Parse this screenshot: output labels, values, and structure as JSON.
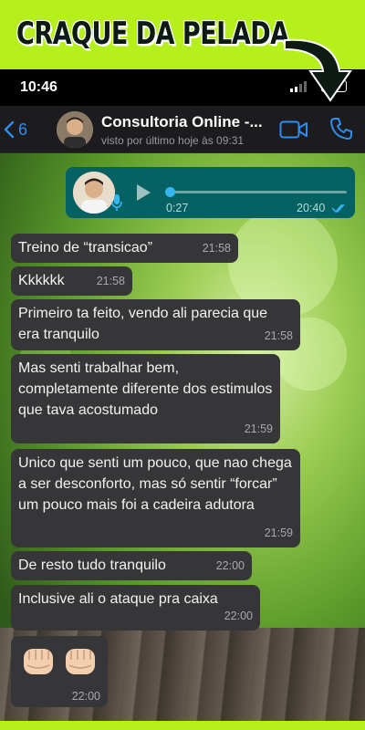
{
  "banner": {
    "title": "CRAQUE DA PELADA"
  },
  "status_bar": {
    "time": "10:46"
  },
  "chat_header": {
    "back_count": "6",
    "contact_name": "Consultoria Online -...",
    "last_seen": "visto por último hoje às 09:31"
  },
  "voice_message": {
    "duration": "0:27",
    "time": "20:40",
    "progress": 0.0
  },
  "messages": [
    {
      "text": "Treino de “transicao”",
      "time": "21:58"
    },
    {
      "text": "Kkkkkk",
      "time": "21:58"
    },
    {
      "text": "Primeiro ta feito, vendo ali parecia que era tranquilo",
      "time": "21:58"
    },
    {
      "text": "Mas senti trabalhar bem, completamente diferente dos estimulos que tava acostumado",
      "time": "21:59"
    },
    {
      "text": "Unico que senti um pouco, que nao chega a ser desconforto, mas só sentir “forcar” um pouco mais foi a cadeira adutora",
      "time": "21:59"
    },
    {
      "text": "De resto tudo tranquilo",
      "time": "22:00"
    },
    {
      "text": "Inclusive ali o ataque pra caixa",
      "time": "22:00"
    }
  ],
  "emoji_message": {
    "emoji": [
      "fist-icon",
      "fist-icon"
    ],
    "time": "22:00"
  },
  "colors": {
    "accent_blue": "#2f8cf0",
    "outgoing_bubble": "#056162",
    "incoming_bubble": "#363638",
    "banner_green": "#b6f01c"
  }
}
